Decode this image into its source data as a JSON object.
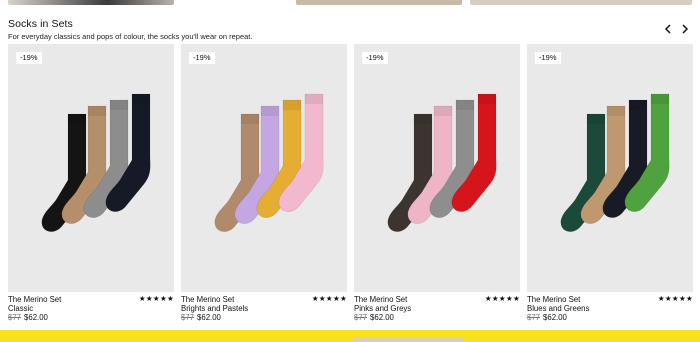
{
  "section": {
    "title": "Socks in Sets",
    "subtitle": "For everyday classics and pops of colour, the socks you'll wear on repeat."
  },
  "nav": {
    "prev_icon": "chevron-left-icon",
    "next_icon": "chevron-right-icon"
  },
  "colors": {
    "bottom_bar": "#f7e11f",
    "badge_bg": "#ffffff",
    "image_bg": "#e9e9e9"
  },
  "products": [
    {
      "badge": "-19%",
      "name": "The Merino Set",
      "variant": "Classic",
      "old_price": "$77",
      "price": "$62.00",
      "rating": "★★★★★",
      "sock_colors": [
        "#141414",
        "#b58f6a",
        "#8d8d8d",
        "#151a26"
      ]
    },
    {
      "badge": "-19%",
      "name": "The Merino Set",
      "variant": "Brights and Pastels",
      "old_price": "$77",
      "price": "$62.00",
      "rating": "★★★★★",
      "sock_colors": [
        "#b18a6c",
        "#c3a6e2",
        "#e6ad34",
        "#f2b8cd"
      ]
    },
    {
      "badge": "-19%",
      "name": "The Merino Set",
      "variant": "Pinks and Greys",
      "old_price": "$77",
      "price": "$62.00",
      "rating": "★★★★★",
      "sock_colors": [
        "#3c352f",
        "#eeb5c7",
        "#8e8e8e",
        "#d5141c"
      ]
    },
    {
      "badge": "-19%",
      "name": "The Merino Set",
      "variant": "Blues and Greens",
      "old_price": "$77",
      "price": "$62.00",
      "rating": "★★★★★",
      "sock_colors": [
        "#1b4a3a",
        "#bf9870",
        "#181a26",
        "#4fa23d"
      ]
    }
  ]
}
